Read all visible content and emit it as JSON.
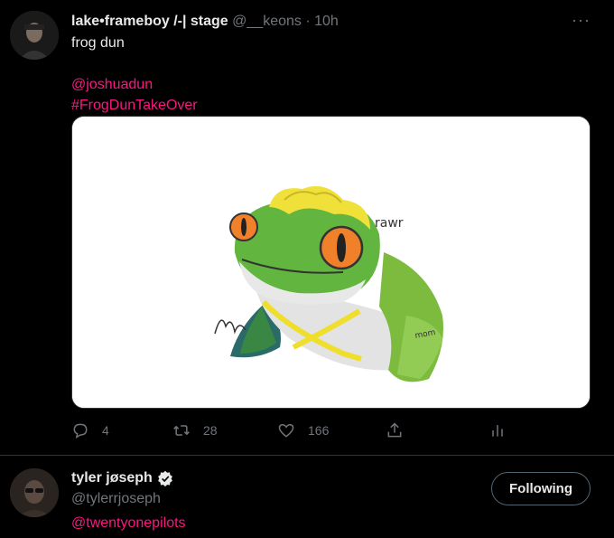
{
  "tweet": {
    "author_name": "lake•frameboy /-| stage",
    "author_handle": "@__keons",
    "separator": "·",
    "time": "10h",
    "text": "frog dun",
    "mention": "@joshuadun",
    "hashtag": "#FrogDunTakeOver",
    "image_text": {
      "rawr": "rawr",
      "mom": "mom"
    },
    "actions": {
      "replies": "4",
      "retweets": "28",
      "likes": "166"
    }
  },
  "suggested_user": {
    "name": "tyler jøseph",
    "verified": true,
    "handle": "@tylerrjoseph",
    "bio_link": "@twentyonepilots",
    "follow_label": "Following"
  },
  "colors": {
    "background": "#000000",
    "text_primary": "#e7e9ea",
    "text_secondary": "#71767b",
    "link": "#f91880",
    "divider": "#2f3336"
  }
}
